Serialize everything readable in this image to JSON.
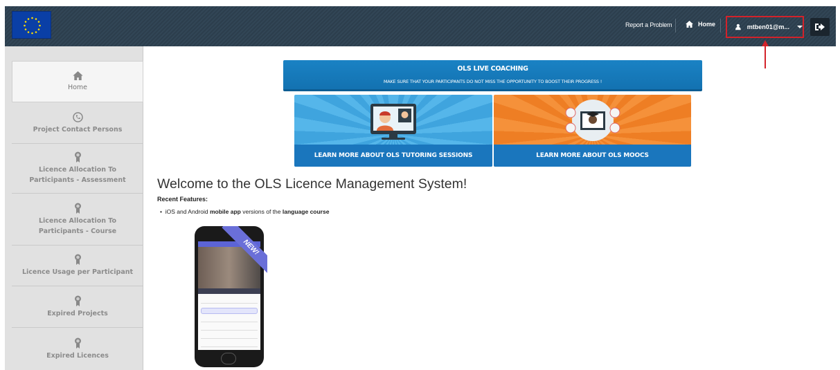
{
  "header": {
    "report_problem": "Report a Problem",
    "home": "Home",
    "user": "mtben01@m..."
  },
  "sidebar": {
    "items": [
      {
        "label": "Home",
        "icon": "home-icon"
      },
      {
        "label": "Project Contact Persons",
        "icon": "phone-icon"
      },
      {
        "label": "Licence Allocation To Participants - Assessment",
        "icon": "award-icon"
      },
      {
        "label": "Licence Allocation To Participants - Course",
        "icon": "award-icon"
      },
      {
        "label": "Licence Usage per Participant",
        "icon": "award-icon"
      },
      {
        "label": "Expired Projects",
        "icon": "award-icon"
      },
      {
        "label": "Expired Licences",
        "icon": "award-icon"
      }
    ]
  },
  "banner": {
    "title": "OLS LIVE COACHING",
    "subtitle": "MAKE SURE THAT YOUR PARTICIPANTS DO NOT MISS THE OPPORTUNITY TO BOOST THEIR PROGRESS !"
  },
  "promos": {
    "tutoring": "LEARN MORE ABOUT OLS TUTORING SESSIONS",
    "moocs": "LEARN MORE ABOUT OLS MOOCS"
  },
  "main": {
    "welcome": "Welcome to the OLS Licence Management System!",
    "recent_label": "Recent Features:",
    "feature_1": "iOS and Android",
    "feature_2": "mobile app",
    "feature_3": "versions of the",
    "feature_4": "language course",
    "new_badge": "NEW!"
  },
  "colors": {
    "header_bg": "#2c3e4d",
    "accent_blue": "#1a76bd",
    "accent_orange": "#f08a2e",
    "highlight_red": "#d3222a"
  }
}
